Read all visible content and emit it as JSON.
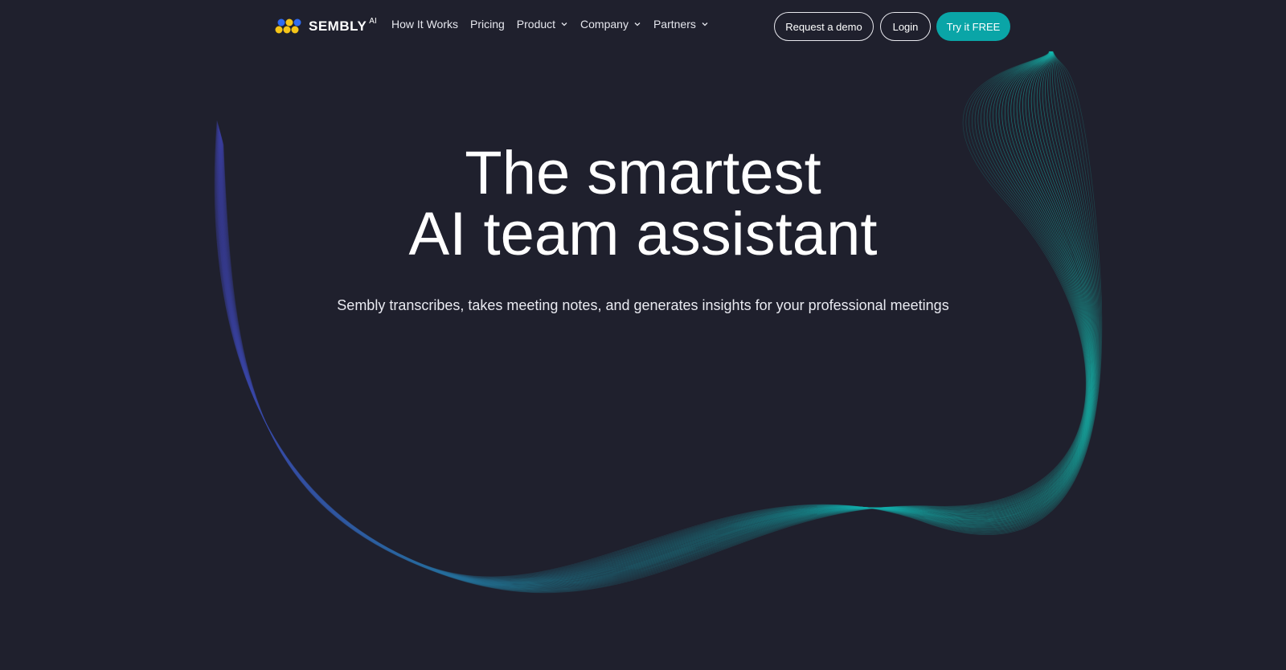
{
  "brand": {
    "name": "SEMBLY",
    "suffix": "AI",
    "colors": {
      "yellow": "#f5c518",
      "blue": "#2f6bf0",
      "teal": "#0aa5a7",
      "background": "#1f202d"
    }
  },
  "nav": {
    "items": [
      {
        "label": "How It Works",
        "dropdown": false
      },
      {
        "label": "Pricing",
        "dropdown": false
      },
      {
        "label": "Product",
        "dropdown": true
      },
      {
        "label": "Company",
        "dropdown": true
      },
      {
        "label": "Partners",
        "dropdown": true
      }
    ]
  },
  "actions": {
    "demo_label": "Request a demo",
    "login_label": "Login",
    "try_label": "Try it FREE"
  },
  "hero": {
    "title_line1": "The smartest",
    "title_line2": "AI team assistant",
    "subtitle": "Sembly transcribes, takes meeting notes, and generates insights for your professional meetings"
  },
  "icons": {
    "logo": "sembly-logo-icon",
    "dropdown": "chevron-down-icon"
  }
}
